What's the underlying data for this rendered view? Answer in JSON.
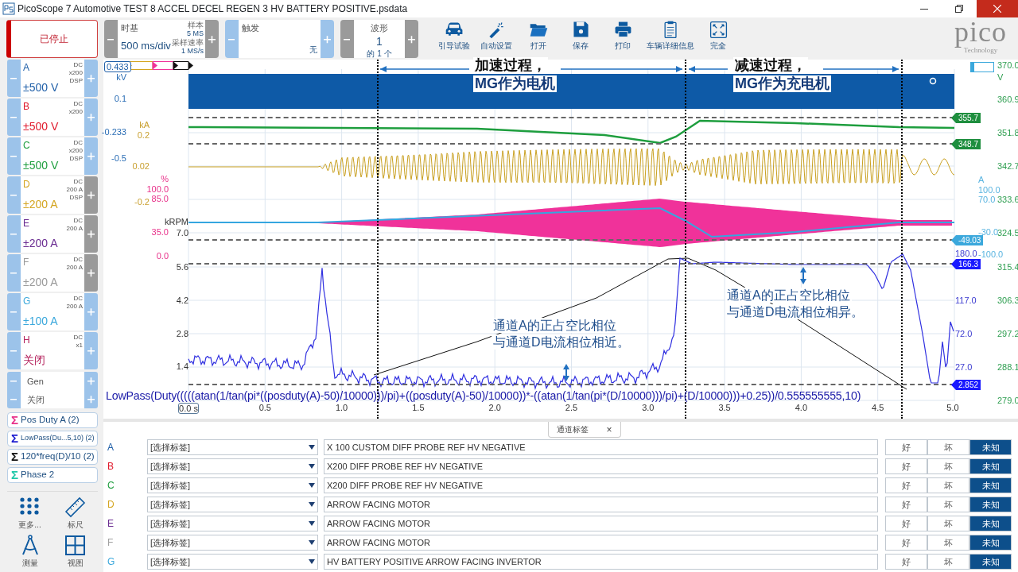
{
  "window": {
    "title": "PicoScope 7 Automotive TEST 8 ACCEL DECEL REGEN 3 HV BATTERY POSITIVE.psdata"
  },
  "toolbar": {
    "run_state": "已停止",
    "timebase": {
      "title": "时基",
      "value": "500 ms/div",
      "samples_label": "样本",
      "samples": "5 MS",
      "rate_label": "采样速率",
      "rate": "1 MS/s"
    },
    "trigger": {
      "title": "触发",
      "mode": "无"
    },
    "waveform": {
      "title": "波形",
      "value": "1",
      "count": "的 1 个"
    },
    "tools": [
      {
        "kind": "car",
        "label": "引导试验"
      },
      {
        "kind": "wand",
        "label": "自动设置"
      },
      {
        "kind": "folder",
        "label": "打开"
      },
      {
        "kind": "save",
        "label": "保存"
      },
      {
        "kind": "print",
        "label": "打印"
      },
      {
        "kind": "clipboard",
        "label": "车辆详细信息"
      },
      {
        "kind": "expand",
        "label": "完全"
      }
    ],
    "logo": {
      "name": "pico",
      "tagline": "Technology"
    }
  },
  "channels": [
    {
      "letter": "A",
      "lines": [
        "DC",
        "x200",
        "DSP"
      ],
      "range": "±500 V",
      "color": "#1f5fa8",
      "plus_disabled": false
    },
    {
      "letter": "B",
      "lines": [
        "DC",
        "x200"
      ],
      "range": "±500 V",
      "color": "#e0192b",
      "plus_disabled": false
    },
    {
      "letter": "C",
      "lines": [
        "DC",
        "x200",
        "DSP"
      ],
      "range": "±500 V",
      "color": "#1e9e3e",
      "plus_disabled": false
    },
    {
      "letter": "D",
      "lines": [
        "DC",
        "200 A",
        "DSP"
      ],
      "range": "±200 A",
      "color": "#d4a520",
      "plus_disabled": true
    },
    {
      "letter": "E",
      "lines": [
        "DC",
        "200 A"
      ],
      "range": "±200 A",
      "color": "#6a2c91",
      "plus_disabled": true
    },
    {
      "letter": "F",
      "lines": [
        "DC",
        "200 A"
      ],
      "range": "±200 A",
      "color": "#9a9a9a",
      "plus_disabled": true
    },
    {
      "letter": "G",
      "lines": [
        "DC",
        "200 A"
      ],
      "range": "±100 A",
      "color": "#3ba8dc",
      "plus_disabled": false
    },
    {
      "letter": "H",
      "lines": [
        "DC",
        "x1"
      ],
      "range": "关闭",
      "color": "#b5245e",
      "plus_disabled": false
    }
  ],
  "generator": [
    "Gen",
    "关闭"
  ],
  "math_channels": [
    {
      "icon": "Σ",
      "label": "Pos Duty A (2)",
      "color": "#e8318a",
      "compact": false
    },
    {
      "icon": "Σ",
      "label": "LowPass(Du...5,10) (2)",
      "color": "#1a1ad0",
      "compact": true
    },
    {
      "icon": "Σ",
      "label": "120*freq(D)/10 (2)",
      "color": "#111111",
      "compact": false
    },
    {
      "icon": "Σ",
      "label": "Phase 2",
      "color": "#1fc8a8",
      "compact": false
    }
  ],
  "side_tools": [
    {
      "kind": "dots",
      "label": "更多..."
    },
    {
      "kind": "ruler",
      "label": "标尺"
    },
    {
      "kind": "compass",
      "label": "测量"
    },
    {
      "kind": "grid",
      "label": "视图"
    }
  ],
  "plot": {
    "readout": "0.433",
    "left_axes": [
      {
        "color": "#2a6db5",
        "labels": [
          "kV",
          "0.1",
          "-0.233",
          "-0.5"
        ]
      },
      {
        "color": "#c9a030",
        "labels": [
          "kA",
          "0.2",
          "0.02",
          "-0.2"
        ]
      },
      {
        "color": "#e8318a",
        "labels": [
          "%",
          "100.0",
          "85.0",
          "35.0",
          "0.0"
        ]
      },
      {
        "color": "#333333",
        "labels": [
          "kRPM",
          "7.0",
          "5.6",
          "4.2",
          "2.8",
          "1.4"
        ]
      }
    ],
    "right_axes": [
      {
        "color": "#3a3ad0",
        "labels": [
          "180.0",
          "117.0",
          "72.0",
          "27.0"
        ]
      },
      {
        "color": "#5ab4e0",
        "labels": [
          "A",
          "100.0",
          "70.0",
          "-30.0",
          "-100.0"
        ]
      },
      {
        "color": "#2e9e50",
        "labels": [
          "370.0",
          "V",
          "360.9",
          "351.8",
          "342.7",
          "333.6",
          "324.5",
          "315.4",
          "306.3",
          "297.2",
          "288.1",
          "279.0"
        ]
      }
    ],
    "markers": [
      {
        "value": "355.7",
        "color": "#1e8e3e"
      },
      {
        "value": "348.7",
        "color": "#1e8e3e"
      },
      {
        "value": "-49.03",
        "color": "#3ba8dc"
      },
      {
        "value": "166.3",
        "color": "#1a1aff"
      },
      {
        "value": "2.852",
        "color": "#1a1aff"
      }
    ],
    "time_axis": [
      "0.0 s",
      "0.5",
      "1.0",
      "1.5",
      "2.0",
      "2.5",
      "3.0",
      "3.5",
      "4.0",
      "4.5",
      "5.0"
    ],
    "formula": "LowPass(Duty(((((atan(1/tan(pi*((posduty(A)-50)/10000)))/pi)+((posduty(A)-50)/10000))*-((atan(1/tan(pi*(D/10000)))/pi)+(D/10000)))+0.25))/0.555555555,10)",
    "annotations": [
      {
        "lines": [
          "加速过程，",
          "MG作为电机"
        ]
      },
      {
        "lines": [
          "减速过程，",
          "MG作为充电机"
        ]
      },
      {
        "lines": [
          "通道A的正占空比相位",
          "与通道D电流相位相近。"
        ]
      },
      {
        "lines": [
          "通道A的正占空比相位",
          "与通道D电流相位相异。"
        ]
      }
    ]
  },
  "channel_labels": {
    "tab": "通道标签",
    "close": "×",
    "rows": [
      {
        "channel": "A",
        "color": "#1f5fa8",
        "tag": "[选择标签]",
        "description": "X 100 CUSTOM DIFF PROBE REF HV NEGATIVE",
        "ratings": [
          {
            "label": "好",
            "selected": false
          },
          {
            "label": "坏",
            "selected": false
          },
          {
            "label": "未知",
            "selected": true
          }
        ]
      },
      {
        "channel": "B",
        "color": "#e0192b",
        "tag": "[选择标签]",
        "description": "X200 DIFF PROBE REF HV NEGATIVE",
        "ratings": [
          {
            "label": "好",
            "selected": false
          },
          {
            "label": "坏",
            "selected": false
          },
          {
            "label": "未知",
            "selected": true
          }
        ]
      },
      {
        "channel": "C",
        "color": "#1e9e3e",
        "tag": "[选择标签]",
        "description": "X200 DIFF PROBE REF HV NEGATIVE",
        "ratings": [
          {
            "label": "好",
            "selected": false
          },
          {
            "label": "坏",
            "selected": false
          },
          {
            "label": "未知",
            "selected": true
          }
        ]
      },
      {
        "channel": "D",
        "color": "#d4a520",
        "tag": "[选择标签]",
        "description": "ARROW FACING MOTOR",
        "ratings": [
          {
            "label": "好",
            "selected": false
          },
          {
            "label": "坏",
            "selected": false
          },
          {
            "label": "未知",
            "selected": true
          }
        ]
      },
      {
        "channel": "E",
        "color": "#6a2c91",
        "tag": "[选择标签]",
        "description": "ARROW FACING MOTOR",
        "ratings": [
          {
            "label": "好",
            "selected": false
          },
          {
            "label": "坏",
            "selected": false
          },
          {
            "label": "未知",
            "selected": true
          }
        ]
      },
      {
        "channel": "F",
        "color": "#a0a0a0",
        "tag": "[选择标签]",
        "description": "ARROW FACING MOTOR",
        "ratings": [
          {
            "label": "好",
            "selected": false
          },
          {
            "label": "坏",
            "selected": false
          },
          {
            "label": "未知",
            "selected": true
          }
        ]
      },
      {
        "channel": "G",
        "color": "#3ba8dc",
        "tag": "[选择标签]",
        "description": "HV BATTERY POSITIVE ARROW FACING INVERTOR",
        "ratings": [
          {
            "label": "好",
            "selected": false
          },
          {
            "label": "坏",
            "selected": false
          },
          {
            "label": "未知",
            "selected": true
          }
        ]
      }
    ]
  }
}
